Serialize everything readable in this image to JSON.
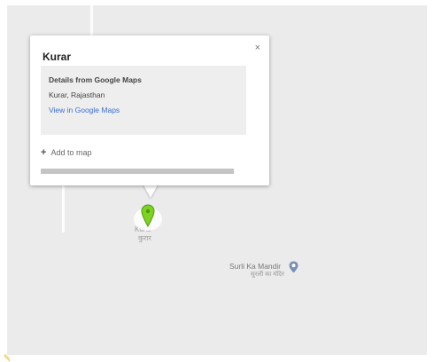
{
  "popup": {
    "title": "Kurar",
    "close_label": "×",
    "details_heading": "Details from Google Maps",
    "address": "Kurar, Rajasthan",
    "link_label": "View in Google Maps",
    "add_plus": "+",
    "add_label": "Add to map"
  },
  "map": {
    "selected_place": {
      "label": "Kurar",
      "native_label": "कुरार",
      "marker_icon": "map-pin-green-icon",
      "marker_color": "#7ed321"
    },
    "poi": {
      "label": "Surli Ka Mandir",
      "native_label": "सुरली का मंदिर",
      "icon": "place-pin-icon",
      "icon_color": "#7b8fb5"
    },
    "background_color": "#ebebeb"
  },
  "colors": {
    "link": "#3b6fd4",
    "details_box": "#eeeeee"
  }
}
